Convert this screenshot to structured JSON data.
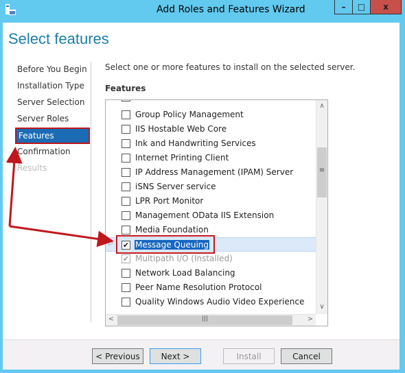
{
  "window": {
    "title": "Add Roles and Features Wizard",
    "minimize": "–",
    "maximize": "□",
    "close": "x"
  },
  "heading": "Select features",
  "nav": [
    {
      "label": "Before You Begin",
      "state": "normal"
    },
    {
      "label": "Installation Type",
      "state": "normal"
    },
    {
      "label": "Server Selection",
      "state": "normal"
    },
    {
      "label": "Server Roles",
      "state": "normal"
    },
    {
      "label": "Features",
      "state": "selected"
    },
    {
      "label": "Confirmation",
      "state": "normal"
    },
    {
      "label": "Results",
      "state": "disabled"
    }
  ],
  "description": "Select one or more features to install on the selected server.",
  "features_label": "Features",
  "features": [
    {
      "label": "Group Policy Management",
      "checked": false
    },
    {
      "label": "IIS Hostable Web Core",
      "checked": false
    },
    {
      "label": "Ink and Handwriting Services",
      "checked": false
    },
    {
      "label": "Internet Printing Client",
      "checked": false
    },
    {
      "label": "IP Address Management (IPAM) Server",
      "checked": false
    },
    {
      "label": "iSNS Server service",
      "checked": false
    },
    {
      "label": "LPR Port Monitor",
      "checked": false
    },
    {
      "label": "Management OData IIS Extension",
      "checked": false
    },
    {
      "label": "Media Foundation",
      "checked": false
    },
    {
      "label": "Message Queuing",
      "checked": true,
      "selected": true
    },
    {
      "label": "Multipath I/O (Installed)",
      "checked": true,
      "disabled": true
    },
    {
      "label": "Network Load Balancing",
      "checked": false
    },
    {
      "label": "Peer Name Resolution Protocol",
      "checked": false
    },
    {
      "label": "Quality Windows Audio Video Experience",
      "checked": false
    }
  ],
  "buttons": {
    "previous": "< Previous",
    "next": "Next >",
    "install": "Install",
    "cancel": "Cancel"
  },
  "colors": {
    "accent": "#1b6cb5",
    "annotation": "#c0161c",
    "frame": "#62c9ef"
  }
}
